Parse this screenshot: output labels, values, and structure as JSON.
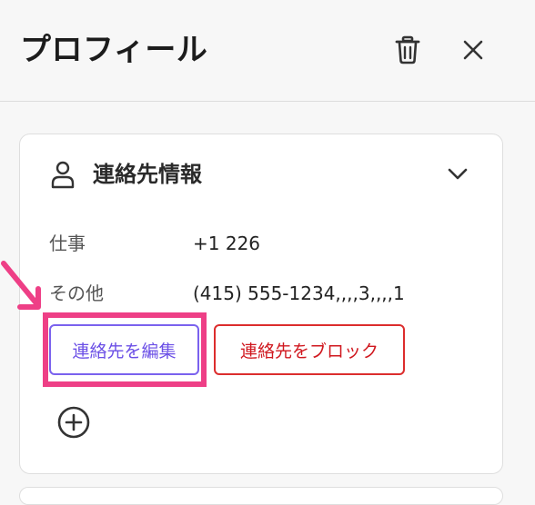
{
  "header": {
    "title": "プロフィール",
    "trash_icon": "trash-icon",
    "close_icon": "close-icon"
  },
  "contact_card": {
    "title": "連絡先情報",
    "person_icon": "person-icon",
    "collapse_icon": "chevron-down-icon",
    "rows": [
      {
        "label": "仕事",
        "value": "+1 226"
      },
      {
        "label": "その他",
        "value": "(415) 555-1234,,,,3,,,,1"
      }
    ],
    "edit_button": "連絡先を編集",
    "block_button": "連絡先をブロック",
    "add_icon": "plus-circle-icon"
  },
  "colors": {
    "accent": "#6b4fe6",
    "danger": "#d0181f",
    "highlight": "#ee3f86"
  }
}
